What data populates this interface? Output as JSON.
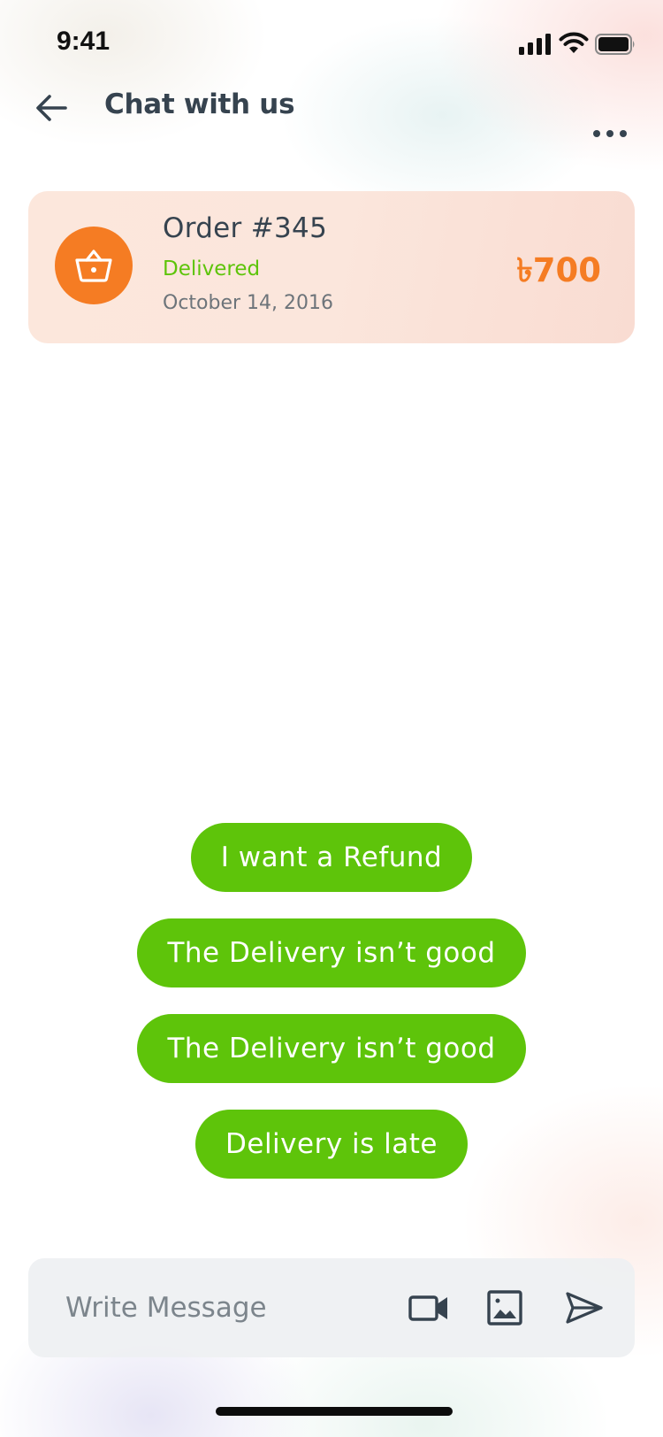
{
  "status_bar": {
    "time": "9:41",
    "icons": [
      "cellular-signal-icon",
      "wifi-icon",
      "battery-icon"
    ]
  },
  "header": {
    "back_icon": "arrow-left-icon",
    "title": "Chat with us",
    "more_icon": "more-horizontal-icon"
  },
  "order": {
    "icon": "basket-icon",
    "number": "Order #345",
    "status": "Delivered",
    "date": "October 14, 2016",
    "price": "৳700"
  },
  "quick_replies": [
    {
      "label": "I want a Refund"
    },
    {
      "label": "The Delivery isn’t good"
    },
    {
      "label": "The Delivery isn’t good"
    },
    {
      "label": "Delivery is late"
    }
  ],
  "composer": {
    "placeholder": "Write Message",
    "value": "",
    "video_icon": "video-camera-icon",
    "image_icon": "image-icon",
    "send_icon": "send-icon"
  },
  "colors": {
    "accent_green": "#5ec40a",
    "accent_orange": "#f57c23",
    "text_dark": "#36434f",
    "text_muted": "#6d747a",
    "card_bg": "#fce7dc",
    "composer_bg": "#eef0f2"
  }
}
